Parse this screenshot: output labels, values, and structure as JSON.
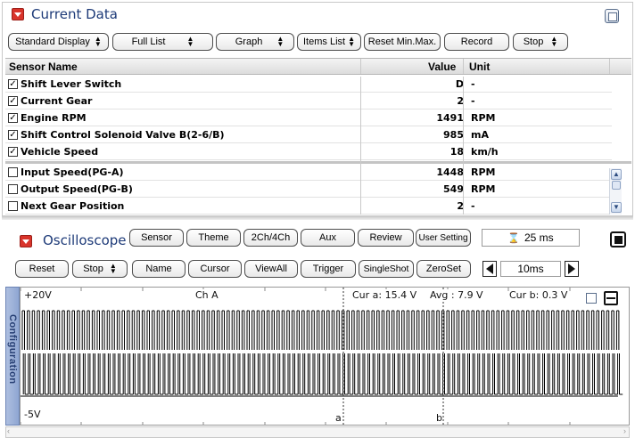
{
  "current_data": {
    "title": "Current Data",
    "toolbar": {
      "display_mode": "Standard Display",
      "list_mode": "Full List",
      "view_mode": "Graph",
      "items_list": "Items List",
      "reset_minmax": "Reset Min.Max.",
      "record": "Record",
      "stop": "Stop"
    },
    "columns": {
      "name": "Sensor Name",
      "value": "Value",
      "unit": "Unit"
    },
    "rows_checked": [
      {
        "name": "Shift Lever Switch",
        "value": "D",
        "unit": "-"
      },
      {
        "name": "Current Gear",
        "value": "2",
        "unit": "-"
      },
      {
        "name": "Engine RPM",
        "value": "1491",
        "unit": "RPM"
      },
      {
        "name": "Shift Control Solenoid Valve B(2-6/B)",
        "value": "985",
        "unit": "mA"
      },
      {
        "name": "Vehicle Speed",
        "value": "18",
        "unit": "km/h"
      }
    ],
    "rows_unchecked": [
      {
        "name": "Input Speed(PG-A)",
        "value": "1448",
        "unit": "RPM"
      },
      {
        "name": "Output Speed(PG-B)",
        "value": "549",
        "unit": "RPM"
      },
      {
        "name": "Next Gear Position",
        "value": "2",
        "unit": "-"
      }
    ],
    "check_mark": "☑"
  },
  "oscilloscope": {
    "title": "Oscilloscope",
    "buttons_top": [
      "Sensor",
      "Theme",
      "2Ch/4Ch",
      "Aux",
      "Review",
      "User Setting"
    ],
    "time_per_div": "25 ms",
    "buttons_bottom": {
      "reset": "Reset",
      "stop": "Stop",
      "name": "Name",
      "cursor": "Cursor",
      "viewall": "ViewAll",
      "trigger": "Trigger",
      "singleshot": "SingleShot",
      "zeroset": "ZeroSet"
    },
    "time_window": "10ms",
    "scope": {
      "y_top": "+20V",
      "y_bottom": "-5V",
      "channel": "Ch A",
      "cur_a": "Cur a: 15.4 V",
      "avg": "Avg  : 7.9 V",
      "cur_b": "Cur b: 0.3 V",
      "cursor_a": "a",
      "cursor_b": "b",
      "waveform_color": "#000000"
    },
    "config_tab": "Configuration"
  },
  "colors": {
    "accent_red": "#d9342b",
    "title_blue": "#1d3a78"
  }
}
